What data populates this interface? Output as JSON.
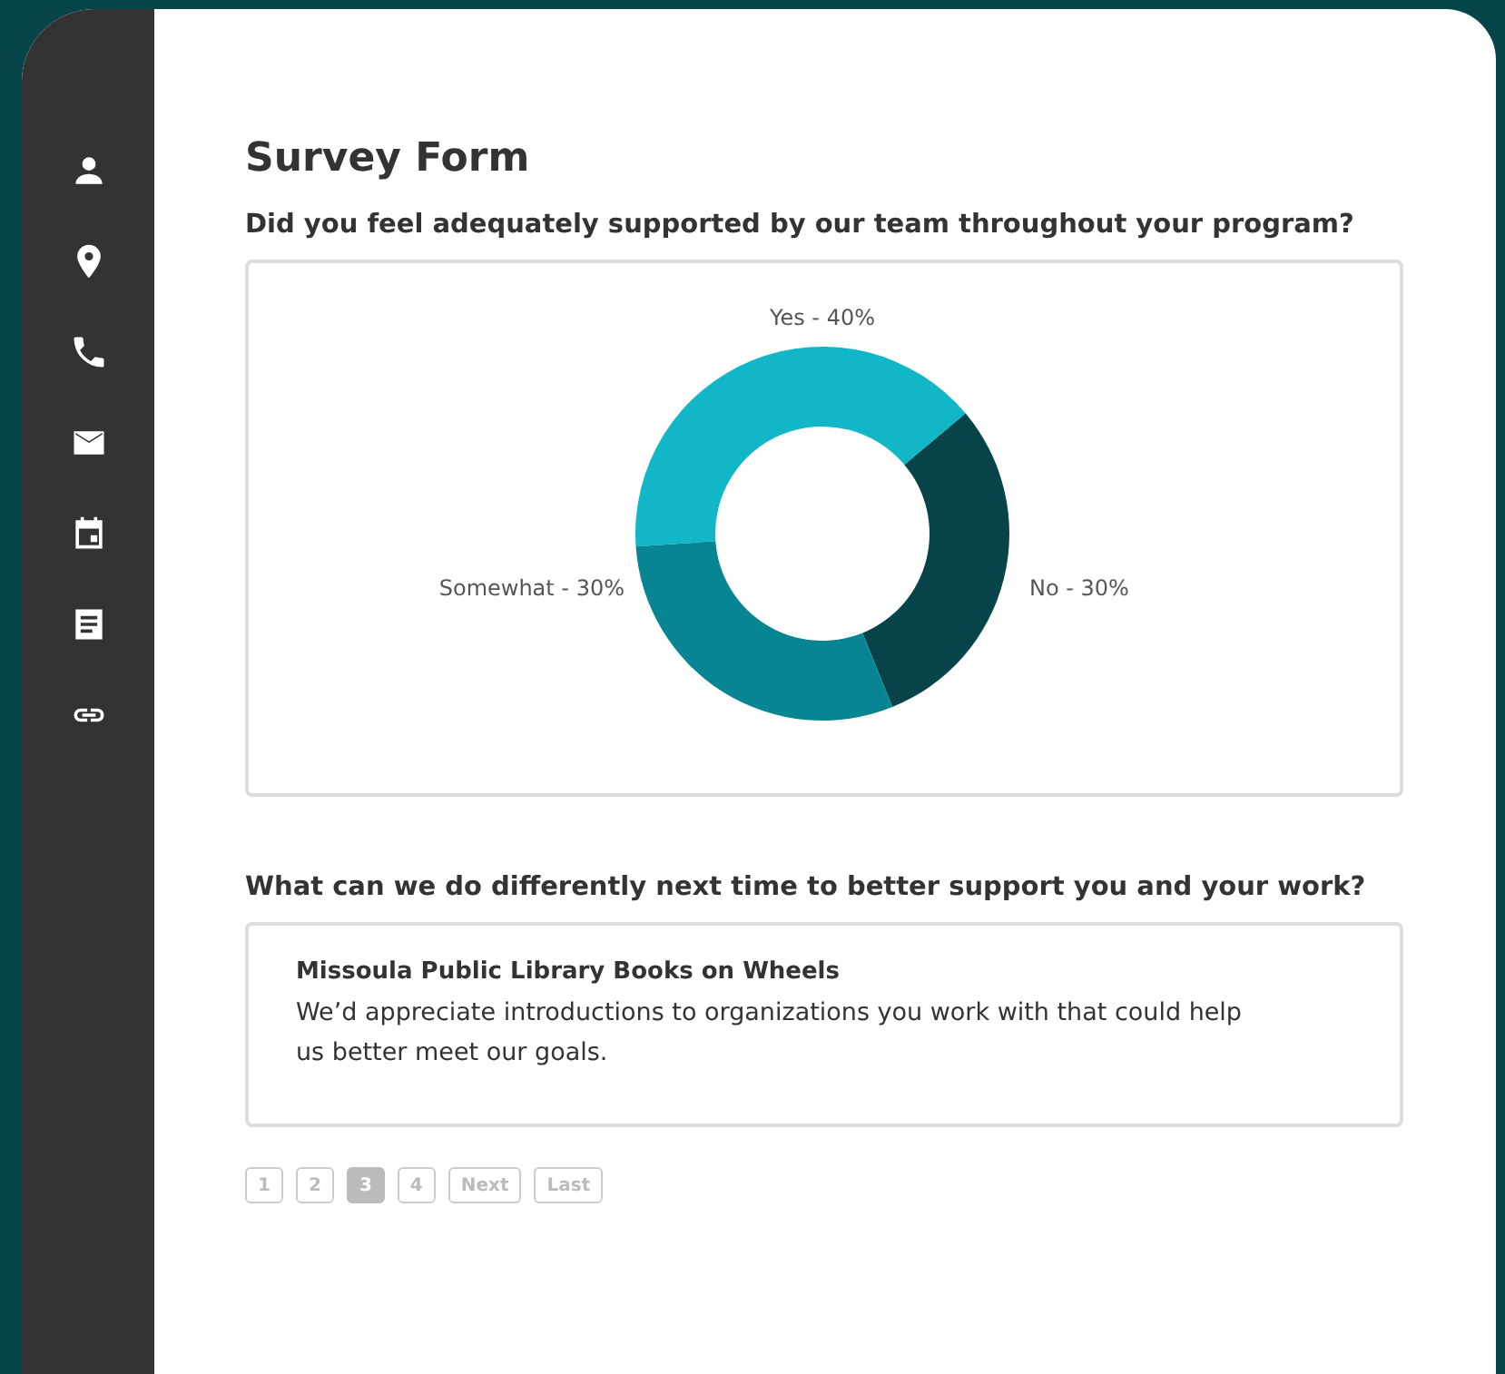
{
  "sidebar": {
    "items": [
      {
        "kind": "person"
      },
      {
        "kind": "pin"
      },
      {
        "kind": "phone"
      },
      {
        "kind": "mail"
      },
      {
        "kind": "calendar"
      },
      {
        "kind": "note"
      },
      {
        "kind": "link"
      }
    ]
  },
  "title": "Survey Form",
  "questions": [
    {
      "kind": "chart",
      "question": "Did you feel adequately supported by our team throughout your program?",
      "chart_data": {
        "type": "donut",
        "categories": [
          "Yes - 40%",
          "No - 30%",
          "Somewhat - 30%"
        ],
        "series": [
          {
            "values": [
              40,
              30,
              30
            ]
          }
        ],
        "colors": [
          "#12b7c7",
          "#06444a",
          "#078592"
        ]
      }
    },
    {
      "kind": "text",
      "question": "What can we do differently next time to better support you and your work?",
      "answer_title": "Missoula Public Library Books on Wheels",
      "answer": "We’d appreciate introductions to organizations you work with that could help us better meet our goals."
    }
  ],
  "pagination": [
    {
      "label": "1",
      "selected": false
    },
    {
      "label": "2",
      "selected": false
    },
    {
      "label": "3",
      "selected": true
    },
    {
      "label": "4",
      "selected": false
    },
    {
      "label": "Next",
      "selected": false
    },
    {
      "label": "Last",
      "selected": false
    }
  ]
}
